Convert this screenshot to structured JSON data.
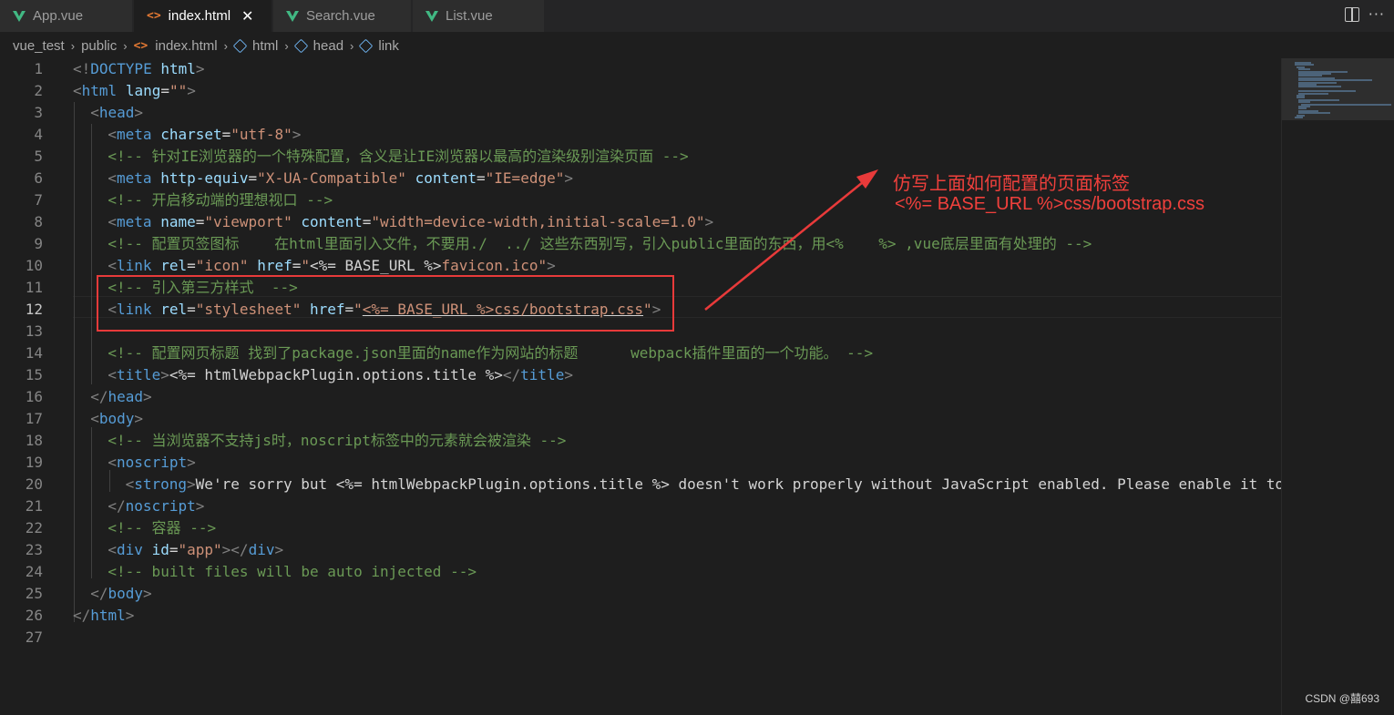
{
  "tabs": [
    {
      "label": "App.vue",
      "icon": "vue-icon",
      "active": false
    },
    {
      "label": "index.html",
      "icon": "html-icon",
      "active": true
    },
    {
      "label": "Search.vue",
      "icon": "vue-icon",
      "active": false
    },
    {
      "label": "List.vue",
      "icon": "vue-icon",
      "active": false
    }
  ],
  "tab_close_glyph": "✕",
  "html_icon_glyph": "<>",
  "breadcrumb": [
    "vue_test",
    "public",
    "index.html",
    "html",
    "head",
    "link"
  ],
  "breadcrumb_sep": "›",
  "line_numbers": [
    "1",
    "2",
    "3",
    "4",
    "5",
    "6",
    "7",
    "8",
    "9",
    "10",
    "11",
    "12",
    "13",
    "14",
    "15",
    "16",
    "17",
    "18",
    "19",
    "20",
    "21",
    "22",
    "23",
    "24",
    "25",
    "26",
    "27"
  ],
  "current_line": "12",
  "code": {
    "l1": [
      "<!",
      "DOCTYPE",
      " ",
      "html",
      ">"
    ],
    "l2": [
      "<",
      "html",
      " ",
      "lang",
      "=",
      "\"\"",
      ">"
    ],
    "l3": [
      "<",
      "head",
      ">"
    ],
    "l4": [
      "<",
      "meta",
      " ",
      "charset",
      "=",
      "\"utf-8\"",
      ">"
    ],
    "l5": "<!-- 针对IE浏览器的一个特殊配置，含义是让IE浏览器以最高的渲染级别渲染页面 -->",
    "l6": [
      "<",
      "meta",
      " ",
      "http-equiv",
      "=",
      "\"X-UA-Compatible\"",
      " ",
      "content",
      "=",
      "\"IE=edge\"",
      ">"
    ],
    "l7": "<!-- 开启移动端的理想视口 -->",
    "l8": [
      "<",
      "meta",
      " ",
      "name",
      "=",
      "\"viewport\"",
      " ",
      "content",
      "=",
      "\"width=device-width,initial-scale=1.0\"",
      ">"
    ],
    "l9": "<!-- 配置页签图标    在html里面引入文件，不要用./  ../ 这些东西别写，引入public里面的东西，用<%    %> ,vue底层里面有处理的 -->",
    "l10": [
      "<",
      "link",
      " ",
      "rel",
      "=",
      "\"icon\"",
      " ",
      "href",
      "=",
      "\"",
      "<%= BASE_URL %>",
      "favicon.ico",
      "\"",
      ">"
    ],
    "l11": "<!-- 引入第三方样式  -->",
    "l12": [
      "<",
      "link",
      " ",
      "rel",
      "=",
      "\"stylesheet\"",
      " ",
      "href",
      "=",
      "\"",
      "<%= BASE_URL %>css/bootstrap.css",
      "\"",
      ">"
    ],
    "l14": "<!-- 配置网页标题 找到了package.json里面的name作为网站的标题      webpack插件里面的一个功能。 -->",
    "l15": [
      "<",
      "title",
      ">",
      "<%= htmlWebpackPlugin.options.title %>",
      "</",
      "title",
      ">"
    ],
    "l16": [
      "</",
      "head",
      ">"
    ],
    "l17": [
      "<",
      "body",
      ">"
    ],
    "l18": "<!-- 当浏览器不支持js时，noscript标签中的元素就会被渲染 -->",
    "l19": [
      "<",
      "noscript",
      ">"
    ],
    "l20": [
      "<",
      "strong",
      ">",
      "We're sorry but ",
      "<%= htmlWebpackPlugin.options.title %>",
      " doesn't work properly without JavaScript enabled. Please enable it to"
    ],
    "l21": [
      "</",
      "noscript",
      ">"
    ],
    "l22": "<!-- 容器 -->",
    "l23": [
      "<",
      "div",
      " ",
      "id",
      "=",
      "\"app\"",
      "></",
      "div",
      ">"
    ],
    "l24": "<!-- built files will be auto injected -->",
    "l25": [
      "</",
      "body",
      ">"
    ],
    "l26": [
      "</",
      "html",
      ">"
    ]
  },
  "annotation": {
    "line1": "仿写上面如何配置的页面标签",
    "line2": "<%= BASE_URL %>css/bootstrap.css",
    "color": "#f0403c"
  },
  "watermark": "CSDN @囍693",
  "colors": {
    "background": "#1e1e1e",
    "tag": "#569cd6",
    "attribute": "#9cdcfe",
    "string": "#ce9178",
    "comment": "#6a9955",
    "vue_icon": "#41b883",
    "html_icon": "#e37933"
  }
}
